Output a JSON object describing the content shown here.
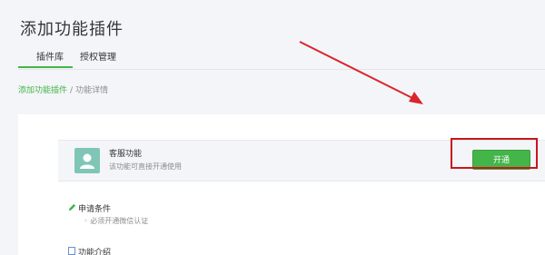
{
  "header": {
    "title": "添加功能插件"
  },
  "tabs": [
    {
      "label": "插件库",
      "active": true
    },
    {
      "label": "授权管理",
      "active": false
    }
  ],
  "breadcrumb": {
    "link": "添加功能插件",
    "separator": "/",
    "current": "功能详情"
  },
  "feature": {
    "icon": "user-avatar-icon",
    "name": "客服功能",
    "description": "该功能可直接开通使用",
    "button_label": "开通"
  },
  "requirements": {
    "icon": "pencil-icon",
    "title": "申请条件",
    "items": [
      "必须开通微信认证"
    ]
  },
  "intro": {
    "icon": "document-icon",
    "title": "功能介绍"
  },
  "colors": {
    "accent": "#44b549",
    "highlight": "#c9161d",
    "background": "#f4f5f9"
  }
}
